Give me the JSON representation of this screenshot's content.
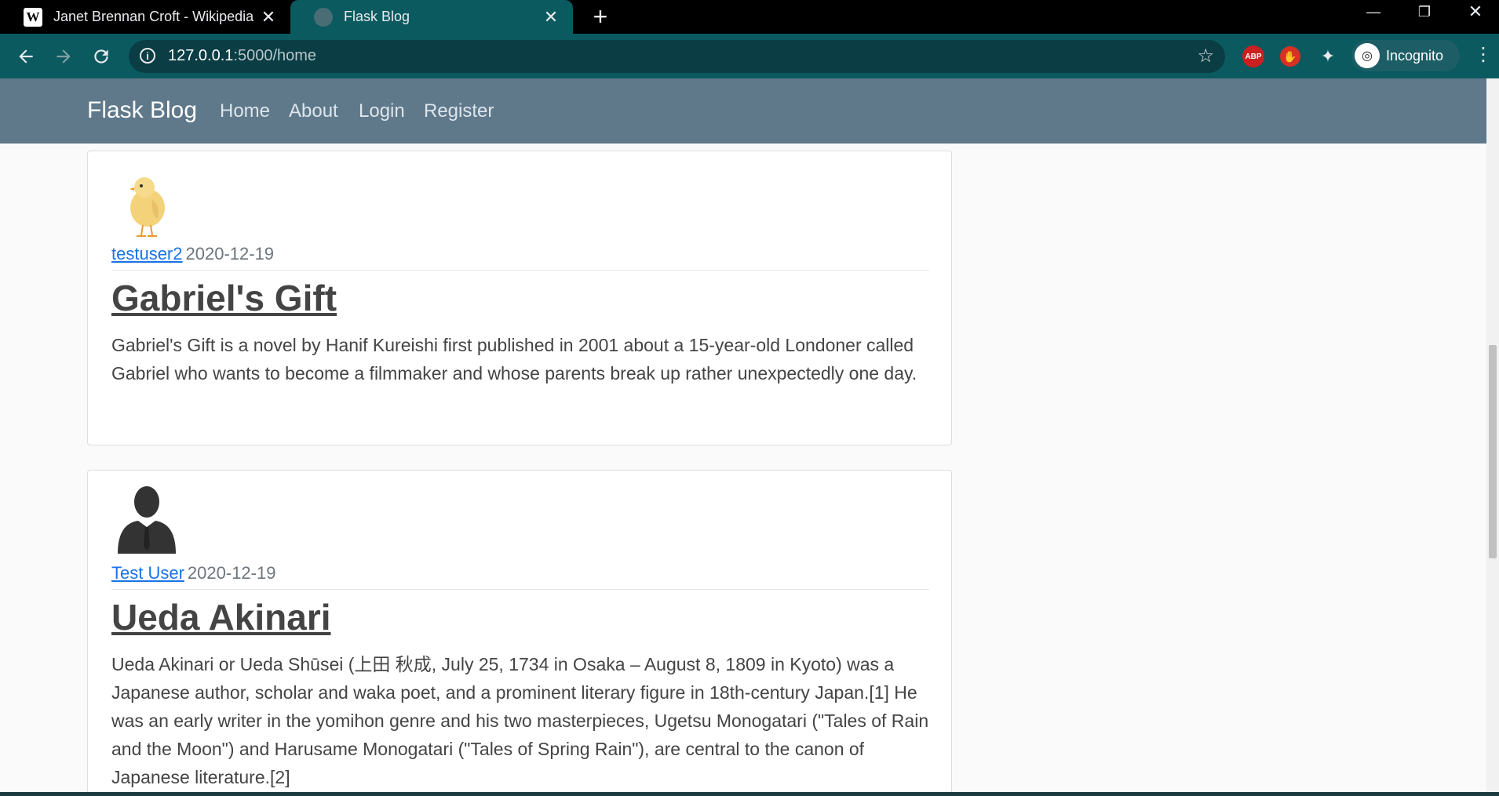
{
  "browser": {
    "tabs": [
      {
        "title": "Janet Brennan Croft - Wikipedia",
        "favicon": "wikipedia-icon",
        "active": false
      },
      {
        "title": "Flask Blog",
        "favicon": "globe-icon",
        "active": true
      }
    ],
    "url_host": "127.0.0.1",
    "url_path": ":5000/home",
    "profile_label": "Incognito",
    "abp_label": "ABP",
    "theme_color": "#0b5a60"
  },
  "site": {
    "brand": "Flask Blog",
    "nav": [
      "Home",
      "About",
      "Login",
      "Register"
    ],
    "nav_color": "#5f788a"
  },
  "posts": [
    {
      "author": "testuser2",
      "date": "2020-12-19",
      "avatar": "chick-avatar",
      "title": "Gabriel's Gift",
      "content": "Gabriel's Gift is a novel by Hanif Kureishi first published in 2001 about a 15-year-old Londoner called Gabriel who wants to become a filmmaker and whose parents break up rather unexpectedly one day."
    },
    {
      "author": "Test User",
      "date": "2020-12-19",
      "avatar": "person-silhouette-avatar",
      "title": "Ueda Akinari",
      "content": "Ueda Akinari or Ueda Shūsei (上田 秋成, July 25, 1734 in Osaka – August 8, 1809 in Kyoto) was a Japanese author, scholar and waka poet, and a prominent literary figure in 18th-century Japan.[1] He was an early writer in the yomihon genre and his two masterpieces, Ugetsu Monogatari (\"Tales of Rain and the Moon\") and Harusame Monogatari (\"Tales of Spring Rain\"), are central to the canon of Japanese literature.[2]"
    }
  ]
}
